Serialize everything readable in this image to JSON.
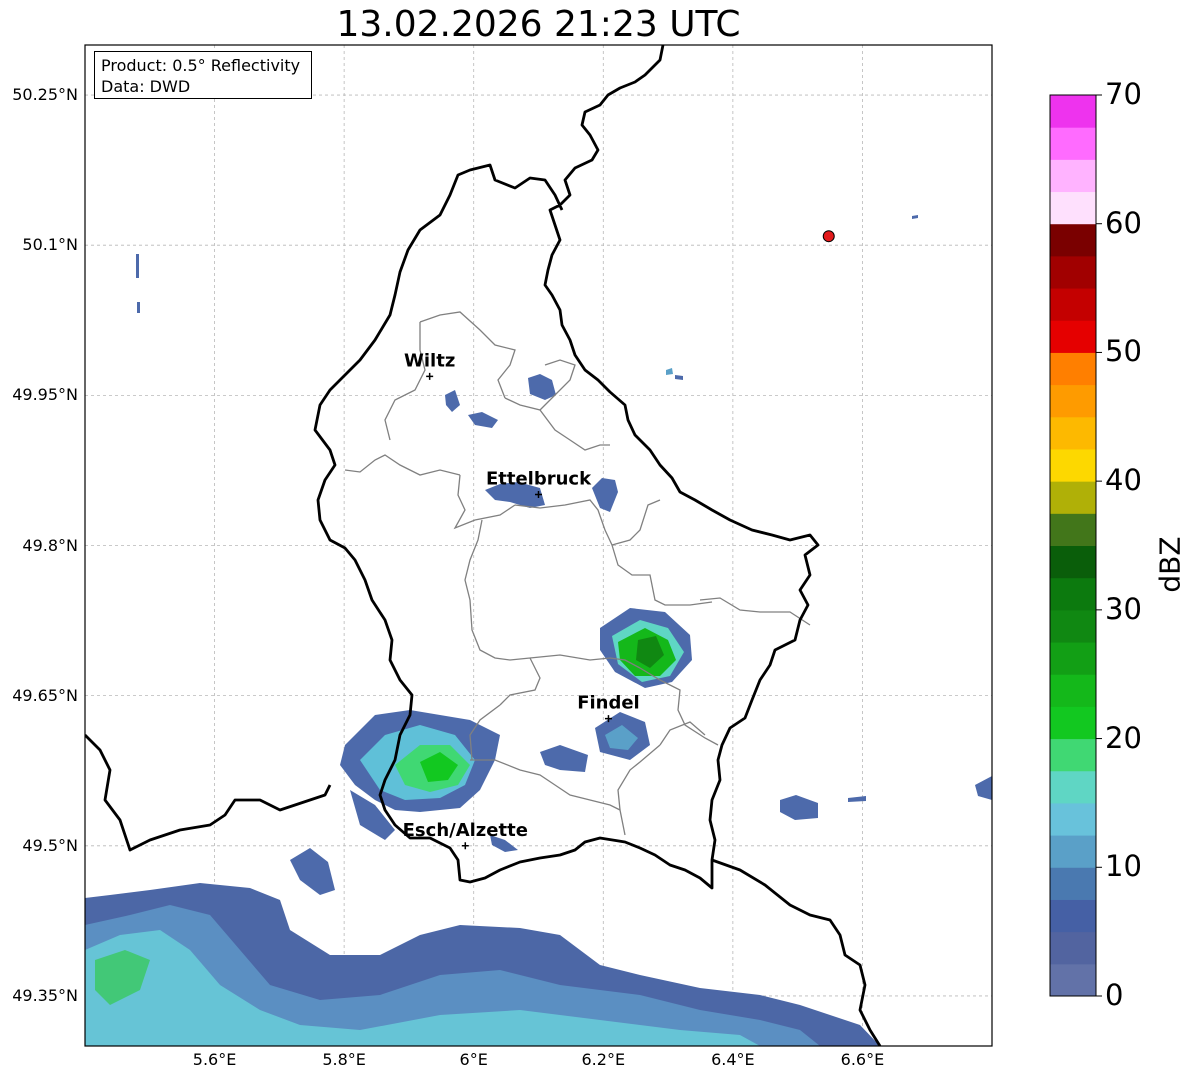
{
  "title": "13.02.2026 21:23 UTC",
  "info": {
    "product": "Product: 0.5° Reflectivity",
    "source": "Data: DWD"
  },
  "axes": {
    "lat_ticks": [
      "50.25°N",
      "50.1°N",
      "49.95°N",
      "49.8°N",
      "49.65°N",
      "49.5°N",
      "49.35°N"
    ],
    "lon_ticks": [
      "5.6°E",
      "5.8°E",
      "6°E",
      "6.2°E",
      "6.4°E",
      "6.6°E"
    ],
    "lat_values": [
      50.25,
      50.1,
      49.95,
      49.8,
      49.65,
      49.5,
      49.35
    ],
    "lon_values": [
      5.6,
      5.8,
      6.0,
      6.2,
      6.4,
      6.6
    ]
  },
  "cities": [
    {
      "name": "Wiltz",
      "lat": 49.969,
      "lon": 5.932
    },
    {
      "name": "Ettelbruck",
      "lat": 49.851,
      "lon": 6.1
    },
    {
      "name": "Findel",
      "lat": 49.627,
      "lon": 6.208
    },
    {
      "name": "Esch/Alzette",
      "lat": 49.5,
      "lon": 5.987
    }
  ],
  "radar_site": {
    "lat": 50.109,
    "lon": 6.548,
    "color": "#e31a1c"
  },
  "colorbar": {
    "label": "dBZ",
    "ticks": [
      "70",
      "60",
      "50",
      "40",
      "30",
      "20",
      "10",
      "0"
    ],
    "colors": [
      "#6272a8",
      "#5264a0",
      "#4560a5",
      "#4a79b0",
      "#5aa0c8",
      "#68c2db",
      "#5fd6c4",
      "#40d873",
      "#12c820",
      "#14b81a",
      "#129f15",
      "#108812",
      "#0c7a0e",
      "#0a5e0a",
      "#42761a",
      "#b0b007",
      "#fdd800",
      "#fdb900",
      "#fe9b00",
      "#ff7f00",
      "#e50000",
      "#c40000",
      "#a10000",
      "#7a0000",
      "#fee0fd",
      "#ffb3ff",
      "#ff6bff",
      "#ee33ee"
    ]
  }
}
